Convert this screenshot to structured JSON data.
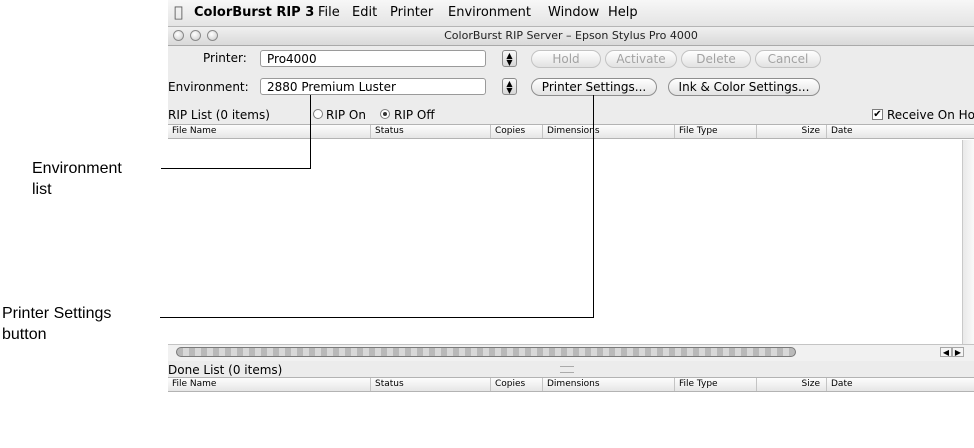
{
  "callouts": {
    "environment_line1": "Environment",
    "environment_line2": "list",
    "printer_line1": "Printer Settings",
    "printer_line2": "button"
  },
  "menubar": {
    "app_name": "ColorBurst RIP 3",
    "items": [
      "File",
      "Edit",
      "Printer",
      "Environment",
      "Window",
      "Help"
    ]
  },
  "window": {
    "title": "ColorBurst RIP Server – Epson Stylus Pro 4000"
  },
  "toolbar": {
    "printer_label": "Printer:",
    "printer_value": "Pro4000",
    "environment_label": "Environment:",
    "environment_value": "2880 Premium Luster",
    "hold": "Hold",
    "activate": "Activate",
    "delete": "Delete",
    "cancel": "Cancel",
    "printer_settings": "Printer Settings...",
    "ink_color_settings": "Ink & Color Settings..."
  },
  "rip_list": {
    "title": "RIP List (0 items)",
    "rip_on": "RIP On",
    "rip_off": "RIP Off",
    "rip_selected": "off",
    "receive_on_hold": "Receive On Hold",
    "receive_on_hold_checked": true
  },
  "done_list": {
    "title": "Done List (0 items)"
  },
  "columns": [
    "File Name",
    "Status",
    "Copies",
    "Dimensions",
    "File Type",
    "Size",
    "Date"
  ],
  "colors": {
    "chrome": "#ececec",
    "pane": "#ffffff",
    "line": "#000000"
  }
}
